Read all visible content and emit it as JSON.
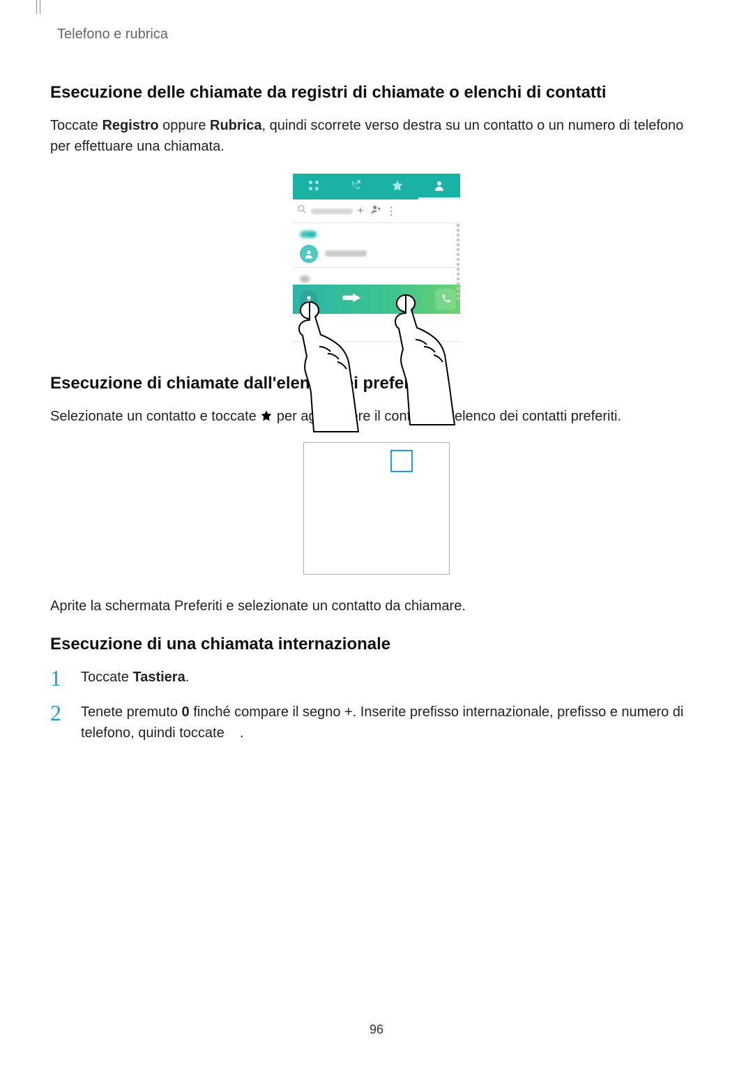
{
  "breadcrumb": "Telefono e rubrica",
  "section1": {
    "heading": "Esecuzione delle chiamate da registri di chiamate o elenchi di contatti",
    "para_parts": {
      "p1": "Toccate ",
      "b1": "Registro",
      "p2": " oppure ",
      "b2": "Rubrica",
      "p3": ", quindi scorrete verso destra su un contatto o un numero di telefono per effettuare una chiamata."
    }
  },
  "figure1": {
    "tabs": [
      "keypad",
      "logs",
      "favorites",
      "contacts"
    ],
    "active_tab_index": 3,
    "search_icons": {
      "plus": "+",
      "add_person": "add-contact",
      "more": "⋮"
    },
    "contact_name": "Samsung",
    "swipe_action": "call"
  },
  "section2": {
    "heading": "Esecuzione di chiamate dall'elenco dei preferiti",
    "para_parts": {
      "p1": "Selezionate un contatto e toccate ",
      "p2": " per aggiungere il contatto all'elenco dei contatti preferiti."
    },
    "followup": "Aprite la schermata Preferiti e selezionate un contatto da chiamare."
  },
  "section3": {
    "heading": "Esecuzione di una chiamata internazionale",
    "steps": [
      {
        "pre": "Toccate ",
        "bold": "Tastiera",
        "post": "."
      },
      {
        "pre": "Tenete premuto ",
        "bold": "0",
        "post": " finché compare il segno +. Inserite prefisso internazionale, prefisso e numero di telefono, quindi toccate ",
        "post2": "."
      }
    ]
  },
  "page_number": "96"
}
